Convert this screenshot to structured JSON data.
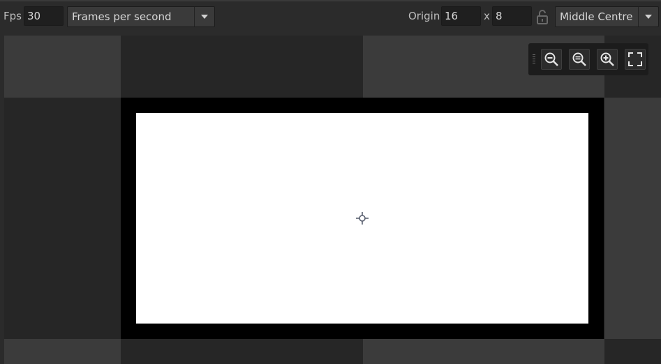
{
  "toolbar": {
    "fps_label": "Fps",
    "fps_value": "30",
    "fps_mode": "Frames per second",
    "origin_label": "Origin",
    "origin_x": "16",
    "origin_sep": "x",
    "origin_y": "8",
    "origin_preset": "Middle Centre"
  },
  "icons": {
    "fps_mode_arrow": "chevron-down-icon",
    "lock": "unlock-icon",
    "preset_arrow": "chevron-down-icon",
    "zoom_out": "zoom-out-icon",
    "zoom_reset": "zoom-reset-icon",
    "zoom_in": "zoom-in-icon",
    "fit": "fit-to-screen-icon",
    "origin_marker": "crosshair-icon"
  },
  "colors": {
    "background": "#2b2b2b",
    "checker_light": "#3b3b3b",
    "checker_dark": "#262626",
    "frame": "#000000",
    "image": "#ffffff"
  }
}
